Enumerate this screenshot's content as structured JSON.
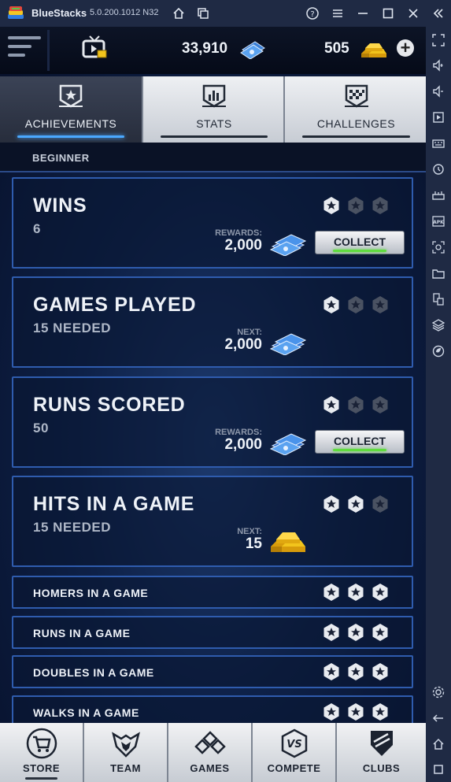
{
  "window": {
    "app_name": "BlueStacks",
    "version": "5.0.200.1012 N32",
    "icons": [
      "home-icon",
      "multi-instance-icon",
      "help-icon",
      "menu-icon",
      "minimize-icon",
      "maximize-icon",
      "close-icon",
      "collapse-sidebar-icon"
    ]
  },
  "sidebar": {
    "icons": [
      "fullscreen-icon",
      "volume-up-icon",
      "volume-down-icon",
      "cast-icon",
      "keyboard-icon",
      "gamepad-icon",
      "controls-icon",
      "apk-install-icon",
      "screenshot-icon",
      "folder-icon",
      "multi-instance-manager-icon",
      "layers-icon",
      "eco-mode-icon",
      "settings-icon",
      "back-icon",
      "android-home-icon",
      "recent-apps-icon"
    ]
  },
  "game": {
    "currency": {
      "cash": "33,910",
      "gold": "505"
    },
    "tabs": [
      {
        "label": "ACHIEVEMENTS",
        "icon": "achievement-badge-icon",
        "active": true
      },
      {
        "label": "STATS",
        "icon": "stats-icon",
        "active": false
      },
      {
        "label": "CHALLENGES",
        "icon": "checkered-flag-icon",
        "active": false
      }
    ],
    "section_header": "BEGINNER",
    "achievements": [
      {
        "title": "WINS",
        "sub": "6",
        "reward_label": "REWARDS:",
        "reward_value": "2,000",
        "reward_type": "cash",
        "button": "COLLECT",
        "stars_earned": 1
      },
      {
        "title": "GAMES PLAYED",
        "sub": "15 NEEDED",
        "reward_label": "NEXT:",
        "reward_value": "2,000",
        "reward_type": "cash",
        "stars_earned": 1
      },
      {
        "title": "RUNS SCORED",
        "sub": "50",
        "reward_label": "REWARDS:",
        "reward_value": "2,000",
        "reward_type": "cash",
        "button": "COLLECT",
        "stars_earned": 1
      },
      {
        "title": "HITS IN A GAME",
        "sub": "15 NEEDED",
        "reward_label": "NEXT:",
        "reward_value": "15",
        "reward_type": "gold",
        "stars_earned": 2
      }
    ],
    "completed": [
      {
        "title": "HOMERS IN A GAME",
        "stars_earned": 3
      },
      {
        "title": "RUNS IN A GAME",
        "stars_earned": 3
      },
      {
        "title": "DOUBLES IN A GAME",
        "stars_earned": 3
      },
      {
        "title": "WALKS IN A GAME",
        "stars_earned": 3
      }
    ],
    "nav": [
      {
        "label": "STORE",
        "icon": "cart-icon"
      },
      {
        "label": "TEAM",
        "icon": "team-eagle-icon"
      },
      {
        "label": "GAMES",
        "icon": "diamonds-icon"
      },
      {
        "label": "COMPETE",
        "icon": "versus-icon"
      },
      {
        "label": "CLUBS",
        "icon": "home-plate-icon"
      }
    ]
  },
  "colors": {
    "accent": "#4aa8ff",
    "card_border": "#2f5cae",
    "collect_glow": "#5fdc3e",
    "gold": "#f2c41c"
  }
}
